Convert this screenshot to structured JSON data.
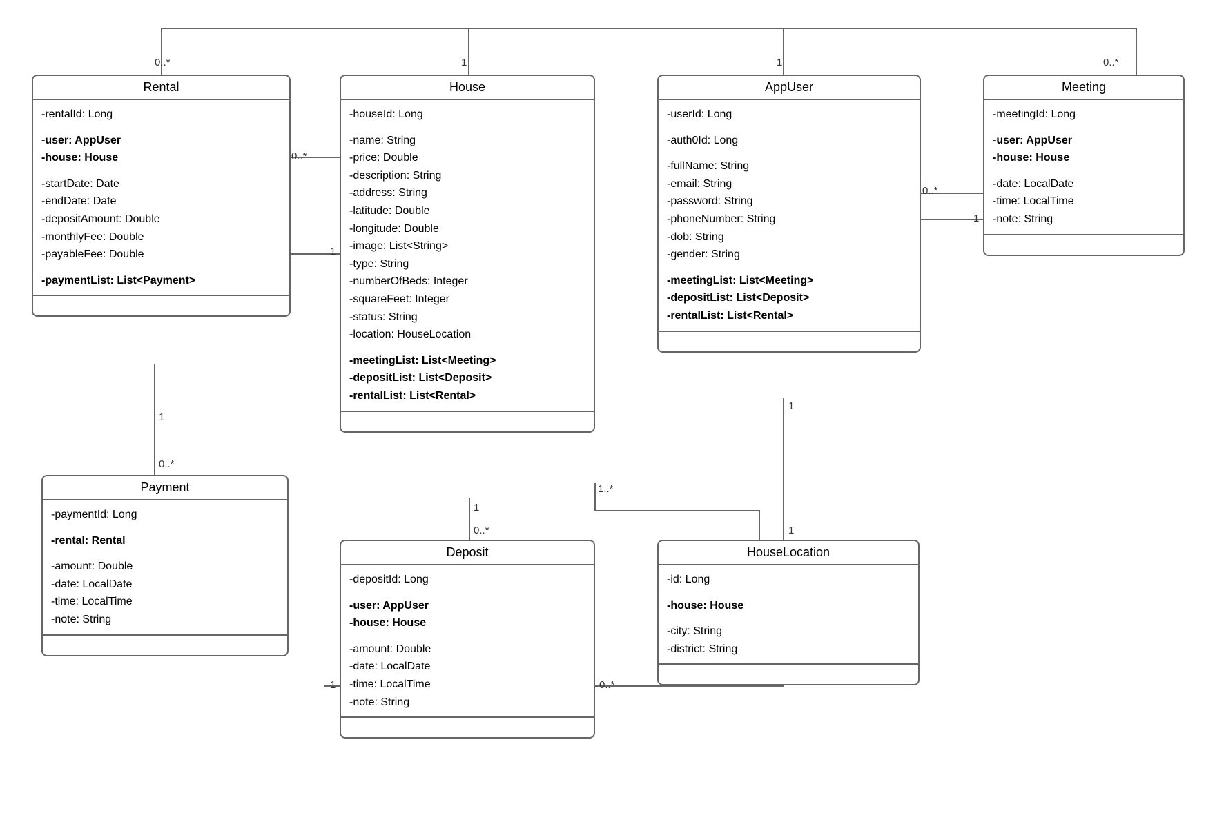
{
  "classes": {
    "rental": {
      "title": "Rental",
      "attrs": [
        {
          "t": "-rentalId: Long"
        },
        {
          "sp": true
        },
        {
          "t": "-user: AppUser",
          "b": true
        },
        {
          "t": "-house: House",
          "b": true
        },
        {
          "sp": true
        },
        {
          "t": "-startDate: Date"
        },
        {
          "t": "-endDate: Date"
        },
        {
          "t": "-depositAmount: Double"
        },
        {
          "t": "-monthlyFee: Double"
        },
        {
          "t": "-payableFee: Double"
        },
        {
          "sp": true
        },
        {
          "t": "-paymentList: List<Payment>",
          "b": true
        }
      ]
    },
    "house": {
      "title": "House",
      "attrs": [
        {
          "t": "-houseId: Long"
        },
        {
          "sp": true
        },
        {
          "t": "-name: String"
        },
        {
          "t": "-price: Double"
        },
        {
          "t": "-description: String"
        },
        {
          "t": "-address: String"
        },
        {
          "t": "-latitude: Double"
        },
        {
          "t": "-longitude: Double"
        },
        {
          "t": "-image: List<String>"
        },
        {
          "t": "-type: String"
        },
        {
          "t": "-numberOfBeds: Integer"
        },
        {
          "t": "-squareFeet: Integer"
        },
        {
          "t": "-status: String"
        },
        {
          "t": "-location: HouseLocation"
        },
        {
          "sp": true
        },
        {
          "t": "-meetingList: List<Meeting>",
          "b": true
        },
        {
          "t": "-depositList: List<Deposit>",
          "b": true
        },
        {
          "t": "-rentalList: List<Rental>",
          "b": true
        }
      ]
    },
    "appuser": {
      "title": "AppUser",
      "attrs": [
        {
          "t": "-userId: Long"
        },
        {
          "sp": true
        },
        {
          "t": "-auth0Id: Long"
        },
        {
          "sp": true
        },
        {
          "t": "-fullName: String"
        },
        {
          "t": "-email: String"
        },
        {
          "t": "-password: String"
        },
        {
          "t": "-phoneNumber: String"
        },
        {
          "t": "-dob: String"
        },
        {
          "t": "-gender: String"
        },
        {
          "sp": true
        },
        {
          "t": "-meetingList: List<Meeting>",
          "b": true
        },
        {
          "t": "-depositList: List<Deposit>",
          "b": true
        },
        {
          "t": "-rentalList: List<Rental>",
          "b": true
        }
      ]
    },
    "meeting": {
      "title": "Meeting",
      "attrs": [
        {
          "t": "-meetingId: Long"
        },
        {
          "sp": true
        },
        {
          "t": "-user: AppUser",
          "b": true
        },
        {
          "t": "-house: House",
          "b": true
        },
        {
          "sp": true
        },
        {
          "t": "-date: LocalDate"
        },
        {
          "t": "-time: LocalTime"
        },
        {
          "t": "-note: String"
        }
      ]
    },
    "payment": {
      "title": "Payment",
      "attrs": [
        {
          "t": "-paymentId: Long"
        },
        {
          "sp": true
        },
        {
          "t": "-rental: Rental",
          "b": true
        },
        {
          "sp": true
        },
        {
          "t": "-amount: Double"
        },
        {
          "t": "-date: LocalDate"
        },
        {
          "t": "-time: LocalTime"
        },
        {
          "t": "-note: String"
        }
      ]
    },
    "deposit": {
      "title": "Deposit",
      "attrs": [
        {
          "t": "-depositId: Long"
        },
        {
          "sp": true
        },
        {
          "t": "-user: AppUser",
          "b": true
        },
        {
          "t": "-house: House",
          "b": true
        },
        {
          "sp": true
        },
        {
          "t": "-amount: Double"
        },
        {
          "t": "-date: LocalDate"
        },
        {
          "t": "-time: LocalTime"
        },
        {
          "t": "-note: String"
        }
      ]
    },
    "houselocation": {
      "title": "HouseLocation",
      "attrs": [
        {
          "t": "-id: Long"
        },
        {
          "sp": true
        },
        {
          "t": "-house: House",
          "b": true
        },
        {
          "sp": true
        },
        {
          "t": "-city: String"
        },
        {
          "t": "-district: String"
        }
      ]
    }
  },
  "multiplicities": {
    "rental_top": "0..*",
    "house_top": "1",
    "appuser_top": "1",
    "meeting_top": "0..*",
    "house_rental_left": "0..*",
    "house_rental_one": "1",
    "appuser_meeting_left": "0..*",
    "appuser_meeting_one": "1",
    "rental_payment_one": "1",
    "rental_payment_many": "0..*",
    "house_deposit_one": "1",
    "house_deposit_many": "0..*",
    "house_houselocation_one": "1..*",
    "house_houselocation_oneR": "1",
    "appuser_deposit_one": "1",
    "appuser_deposit_many": "0..*"
  },
  "chart_data": {
    "type": "class-diagram",
    "classes": [
      "Rental",
      "House",
      "AppUser",
      "Meeting",
      "Payment",
      "Deposit",
      "HouseLocation"
    ],
    "relationships": [
      {
        "from": "Rental",
        "to": "AppUser",
        "mult_from": "0..*",
        "mult_to": "1"
      },
      {
        "from": "Rental",
        "to": "House",
        "mult_from": "0..*",
        "mult_to": "1"
      },
      {
        "from": "Meeting",
        "to": "AppUser",
        "mult_from": "0..*",
        "mult_to": "1"
      },
      {
        "from": "Meeting",
        "to": "House",
        "mult_from": "0..*",
        "mult_to": "1"
      },
      {
        "from": "Payment",
        "to": "Rental",
        "mult_from": "0..*",
        "mult_to": "1"
      },
      {
        "from": "Deposit",
        "to": "House",
        "mult_from": "0..*",
        "mult_to": "1"
      },
      {
        "from": "Deposit",
        "to": "AppUser",
        "mult_from": "0..*",
        "mult_to": "1"
      },
      {
        "from": "House",
        "to": "HouseLocation",
        "mult_from": "1..*",
        "mult_to": "1"
      }
    ]
  }
}
